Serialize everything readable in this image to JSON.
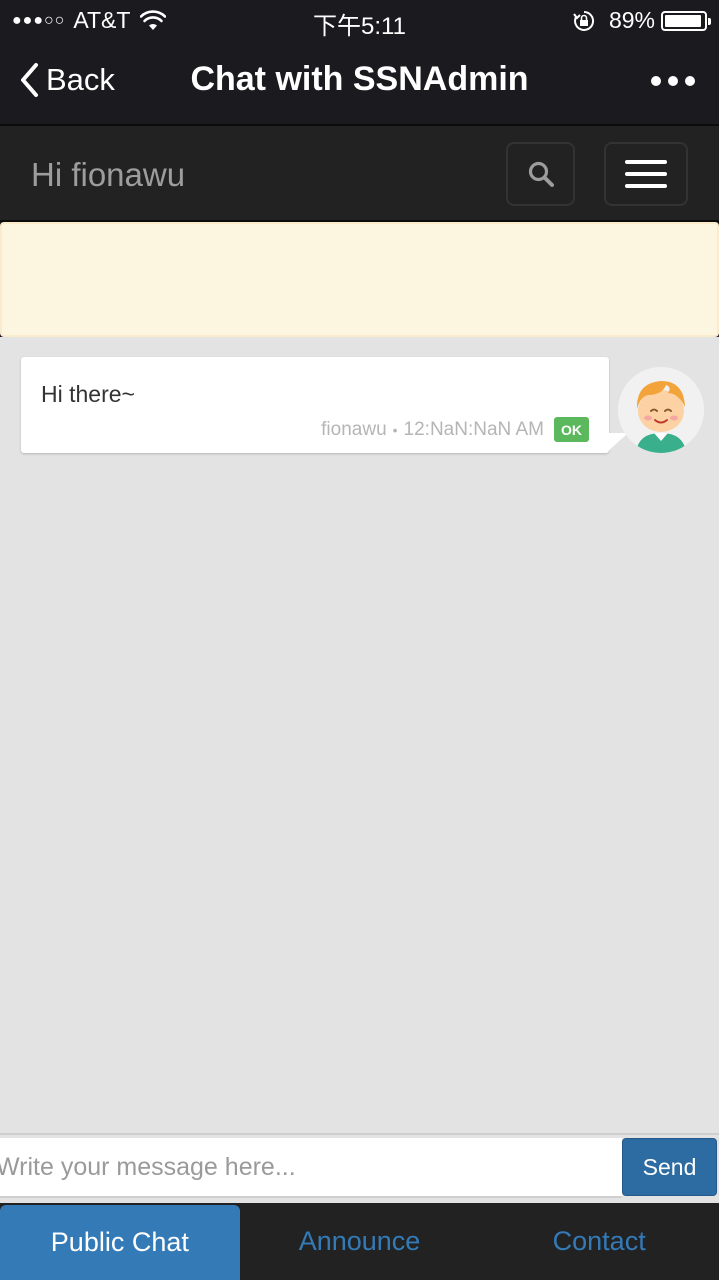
{
  "status_bar": {
    "signal": "●●●○○",
    "carrier": "AT&T",
    "time": "下午5:11",
    "battery_percent": "89%",
    "battery_level": 0.89
  },
  "navbar": {
    "back_label": "Back",
    "title": "Chat with SSNAdmin"
  },
  "header": {
    "greeting": "Hi fionawu"
  },
  "messages": [
    {
      "text": "Hi there~",
      "sender": "fionawu",
      "separator": "•",
      "time": "12:NaN:NaN AM",
      "status": "OK"
    }
  ],
  "composer": {
    "placeholder": "Write your message here...",
    "send_label": "Send"
  },
  "tabs": [
    {
      "label": "Public Chat",
      "active": true
    },
    {
      "label": "Announce",
      "active": false
    },
    {
      "label": "Contact",
      "active": false
    }
  ],
  "colors": {
    "primary": "#337ab7",
    "send_button": "#2d6ca2",
    "ok_badge": "#5cb85c",
    "alert_bg": "#fcf6e0",
    "chat_bg": "#e3e3e3"
  }
}
